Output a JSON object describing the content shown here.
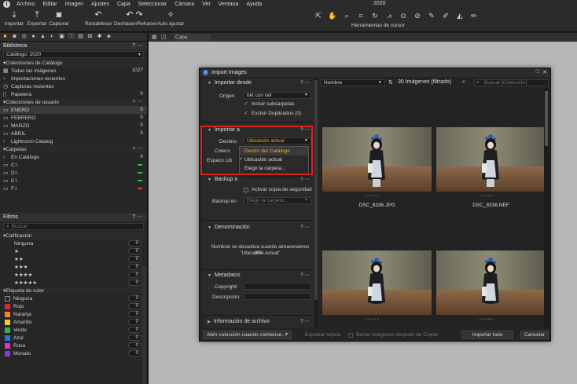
{
  "menubar": {
    "items": [
      "Archivo",
      "Editar",
      "Imagen",
      "Ajustes",
      "Capa",
      "Seleccionar",
      "Cámara",
      "Ver",
      "Ventana",
      "Ayuda"
    ],
    "doc_title": "2020"
  },
  "toolbar": {
    "import": "Importar",
    "export": "Exportar",
    "capture": "Capturar",
    "reset": "Restablecer",
    "undo_redo": "Deshacer/Rehacer",
    "auto_adjust": "Auto ajustar",
    "cursor_tools": "Herramientas de cursor"
  },
  "library": {
    "title": "Biblioteca",
    "catalog": "Catálogo: 2020",
    "catalog_collections": {
      "title": "Colecciones de Catálogo",
      "items": [
        {
          "label": "Todas las imágenes",
          "count": "1027"
        },
        {
          "label": "Importaciones recientes",
          "count": ""
        },
        {
          "label": "Capturas recientes",
          "count": ""
        },
        {
          "label": "Papelera",
          "count": "0"
        }
      ]
    },
    "user_collections": {
      "title": "Colecciones de usuario",
      "items": [
        {
          "label": "ENERO",
          "count": "0"
        },
        {
          "label": "FEBRERO",
          "count": "0"
        },
        {
          "label": "MARZO",
          "count": "0"
        },
        {
          "label": "ABRIL",
          "count": "0"
        },
        {
          "label": "Lightroom Catalog",
          "count": ""
        }
      ]
    },
    "folders": {
      "title": "Carpetas",
      "items": [
        {
          "label": "En Catálogo",
          "count": "0"
        },
        {
          "label": "C:\\"
        },
        {
          "label": "D:\\"
        },
        {
          "label": "E:\\"
        },
        {
          "label": "F:\\"
        }
      ]
    }
  },
  "filters": {
    "title": "Filtros",
    "search_placeholder": "Buscar",
    "rating_title": "Calificación",
    "ratings": [
      {
        "label": "Ninguna",
        "count": "0"
      },
      {
        "label": "★",
        "count": "0"
      },
      {
        "label": "★★",
        "count": "0"
      },
      {
        "label": "★★★",
        "count": "0"
      },
      {
        "label": "★★★★",
        "count": "0"
      },
      {
        "label": "★★★★★",
        "count": "0"
      }
    ],
    "color_title": "Etiqueta de color",
    "colors": [
      {
        "label": "Ninguna",
        "count": "0",
        "color": ""
      },
      {
        "label": "Rojo",
        "count": "0",
        "color": "#d92b2b"
      },
      {
        "label": "Naranja",
        "count": "0",
        "color": "#f08a1c"
      },
      {
        "label": "Amarillo",
        "count": "0",
        "color": "#e8d21f"
      },
      {
        "label": "Verde",
        "count": "0",
        "color": "#2fb34a"
      },
      {
        "label": "Azul",
        "count": "0",
        "color": "#2f6fd6"
      },
      {
        "label": "Rosa",
        "count": "0",
        "color": "#d637c8"
      },
      {
        "label": "Morado",
        "count": "0",
        "color": "#8a3bd6"
      }
    ]
  },
  "viewer": {
    "layer_select": "Capa"
  },
  "dialog": {
    "title": "Import Images",
    "import_from": {
      "title": "Importar desde",
      "origin_label": "Origen",
      "origin_value": "bkt con rail",
      "include_subfolders": "Incluir subcarpetas",
      "exclude_duplicates": "Excluir Duplicados (0)"
    },
    "import_to": {
      "title": "Importar a",
      "dest_label": "Destino",
      "dest_value": "Ubicación actual",
      "collection_label": "Colecc",
      "space_label": "Espaco Lib",
      "options": [
        "Dentro del Catálogo",
        "Ubicación actual",
        "Elegir la carpeta..."
      ]
    },
    "backup": {
      "title": "Backup a",
      "activate": "Activar copia de seguridad",
      "backup_label": "Backup en",
      "backup_value": "Elegir la carpeta..."
    },
    "naming": {
      "title": "Denominación",
      "note1": "Nombrar se desactiva cuando almacenamos arc...",
      "note2": "\"Ubicación Actual\""
    },
    "metadata": {
      "title": "Metadatos",
      "copyright": "Copyright:",
      "description": "Descripción:"
    },
    "file_info": {
      "title": "Información de archivo"
    },
    "browser": {
      "sort": "Nombre",
      "count": "30 Imágenes (filtrado)",
      "search_placeholder": "Buscar [Colección]",
      "thumbs": [
        {
          "caption": "DSC_8336.JPG"
        },
        {
          "caption": "DSC_8336.NEF"
        },
        {
          "caption": ""
        },
        {
          "caption": ""
        }
      ]
    },
    "footer": {
      "open_collection": "Abrir colección cuando comience...",
      "eject_card": "Expulsar tarjeta",
      "delete_after": "Borrar imágenes después de Copiar",
      "import_all": "Importar todo",
      "cancel": "Cancelar"
    }
  }
}
